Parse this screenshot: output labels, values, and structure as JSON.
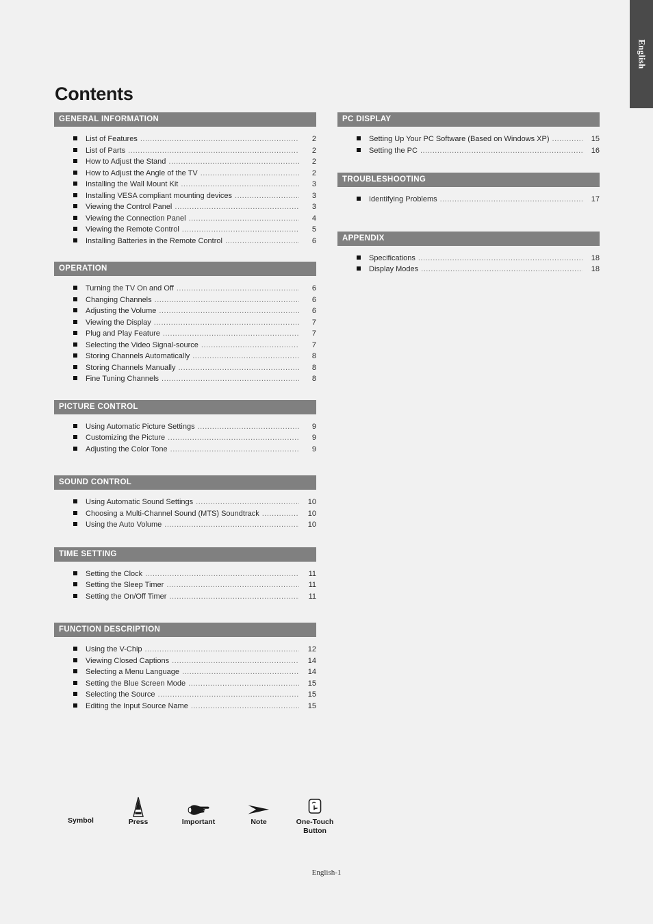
{
  "page": {
    "title": "Contents",
    "language_tab": "English",
    "footer": "English-1",
    "colors": {
      "background": "#f1f1f1",
      "section_header_bg": "#808080",
      "section_header_text": "#ffffff",
      "tab_bg": "#4a4a4a",
      "body_text": "#2b2b2b",
      "leader_dots": "#6e6e6e"
    }
  },
  "left_column": [
    {
      "heading": "GENERAL INFORMATION",
      "items": [
        {
          "label": "List of Features",
          "page": "2"
        },
        {
          "label": "List of Parts",
          "page": "2"
        },
        {
          "label": "How to Adjust the Stand",
          "page": "2"
        },
        {
          "label": "How to Adjust the Angle of the TV",
          "page": "2"
        },
        {
          "label": "Installing the Wall Mount Kit",
          "page": "3"
        },
        {
          "label": "Installing VESA compliant mounting devices",
          "page": "3"
        },
        {
          "label": "Viewing the Control Panel",
          "page": "3"
        },
        {
          "label": "Viewing the Connection Panel",
          "page": "4"
        },
        {
          "label": "Viewing the Remote Control",
          "page": "5"
        },
        {
          "label": "Installing Batteries in the Remote Control",
          "page": "6"
        }
      ]
    },
    {
      "heading": "OPERATION",
      "items": [
        {
          "label": "Turning the TV On and Off",
          "page": "6"
        },
        {
          "label": "Changing Channels",
          "page": "6"
        },
        {
          "label": "Adjusting the Volume",
          "page": "6"
        },
        {
          "label": "Viewing the Display",
          "page": "7"
        },
        {
          "label": "Plug and Play Feature",
          "page": "7"
        },
        {
          "label": "Selecting the Video Signal-source",
          "page": "7"
        },
        {
          "label": "Storing Channels Automatically",
          "page": "8"
        },
        {
          "label": "Storing Channels Manually",
          "page": "8"
        },
        {
          "label": "Fine Tuning Channels",
          "page": "8"
        }
      ]
    },
    {
      "heading": "PICTURE CONTROL",
      "items": [
        {
          "label": "Using Automatic Picture Settings",
          "page": "9"
        },
        {
          "label": "Customizing the Picture",
          "page": "9"
        },
        {
          "label": "Adjusting the Color Tone",
          "page": "9"
        }
      ]
    },
    {
      "heading": "SOUND CONTROL",
      "items": [
        {
          "label": "Using Automatic Sound Settings",
          "page": "10"
        },
        {
          "label": "Choosing a Multi-Channel Sound (MTS) Soundtrack",
          "page": "10"
        },
        {
          "label": "Using the Auto Volume",
          "page": "10"
        }
      ]
    },
    {
      "heading": "TIME SETTING",
      "items": [
        {
          "label": "Setting the Clock",
          "page": "11"
        },
        {
          "label": "Setting the Sleep Timer",
          "page": "11"
        },
        {
          "label": "Setting the On/Off Timer",
          "page": "11"
        }
      ]
    },
    {
      "heading": "FUNCTION DESCRIPTION",
      "items": [
        {
          "label": "Using the V-Chip",
          "page": "12"
        },
        {
          "label": "Viewing Closed Captions",
          "page": "14"
        },
        {
          "label": "Selecting a Menu Language",
          "page": "14"
        },
        {
          "label": "Setting the Blue Screen Mode",
          "page": "15"
        },
        {
          "label": "Selecting the Source",
          "page": "15"
        },
        {
          "label": "Editing the Input Source Name",
          "page": "15"
        }
      ]
    }
  ],
  "right_column": [
    {
      "heading": "PC DISPLAY",
      "items": [
        {
          "label": "Setting Up Your PC Software (Based on Windows XP)",
          "page": "15"
        },
        {
          "label": "Setting the PC",
          "page": "16"
        }
      ]
    },
    {
      "heading": "TROUBLESHOOTING",
      "items": [
        {
          "label": "Identifying Problems",
          "page": "17"
        }
      ]
    },
    {
      "heading": "APPENDIX",
      "items": [
        {
          "label": "Specifications",
          "page": "18"
        },
        {
          "label": "Display Modes",
          "page": "18"
        }
      ]
    }
  ],
  "legend": [
    {
      "icon": "none",
      "label": "Symbol"
    },
    {
      "icon": "press-triangle-icon",
      "label": "Press"
    },
    {
      "icon": "pointing-hand-icon",
      "label": "Important"
    },
    {
      "icon": "arrow-dart-icon",
      "label": "Note"
    },
    {
      "icon": "one-touch-button-icon",
      "label": "One-Touch\nButton"
    }
  ]
}
